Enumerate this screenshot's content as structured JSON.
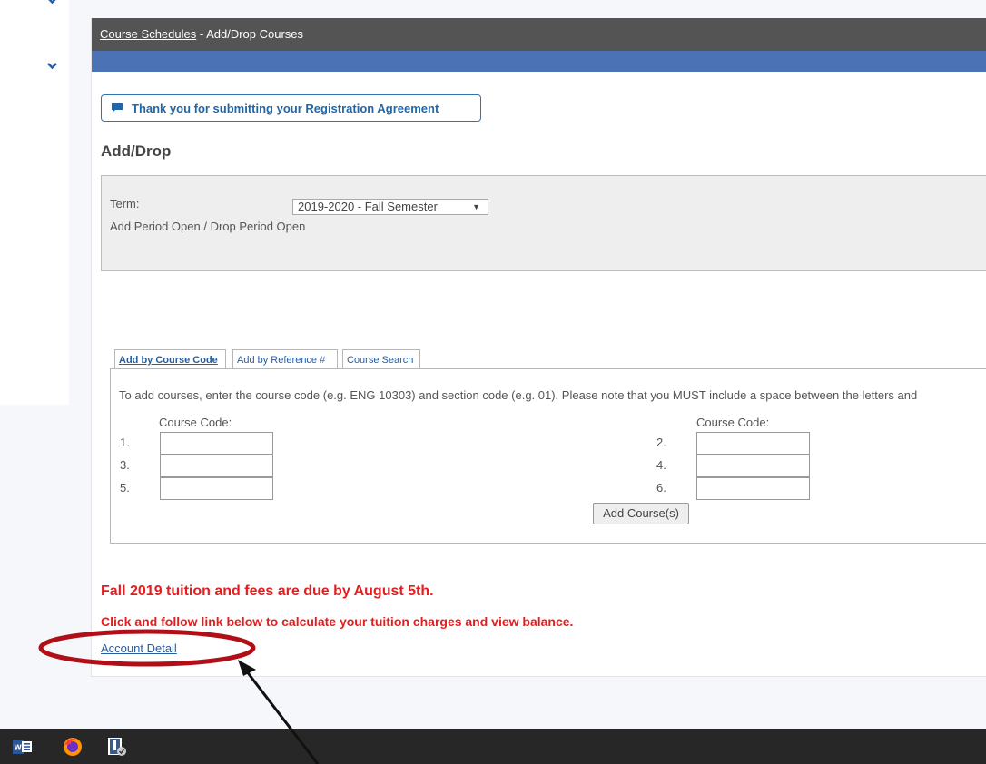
{
  "breadcrumb": {
    "link": "Course Schedules",
    "separator": " - ",
    "current": "Add/Drop Courses"
  },
  "notice": {
    "text": "Thank you for submitting your Registration Agreement",
    "icon": "comment-icon"
  },
  "page_title": "Add/Drop",
  "term": {
    "label": "Term:",
    "selected": "2019-2020 - Fall Semester",
    "period_status": "Add Period Open / Drop Period Open"
  },
  "tabs": [
    {
      "label": "Add by Course Code",
      "active": true
    },
    {
      "label": "Add by Reference #",
      "active": false
    },
    {
      "label": "Course Search",
      "active": false
    }
  ],
  "add_form": {
    "instructions": "To add courses, enter the course code (e.g. ENG 10303) and section code (e.g. 01). Please note that you MUST include a space between the letters and",
    "column_header": "Course Code:",
    "rows": [
      "1.",
      "2.",
      "3.",
      "4.",
      "5.",
      "6."
    ],
    "button": "Add Course(s)"
  },
  "due_notice": "Fall 2019 tuition and fees are due by August 5th.",
  "link_notice": "Click and follow link below to calculate your tuition charges and view balance.",
  "account_link": "Account Detail",
  "taskbar": {
    "apps": [
      "word-icon",
      "firefox-icon",
      "app-icon"
    ]
  },
  "colors": {
    "header": "#545454",
    "accent_bar": "#4a72b5",
    "link": "#2a5d9c",
    "alert": "#e41e1e",
    "annotation": "#b00f18"
  }
}
